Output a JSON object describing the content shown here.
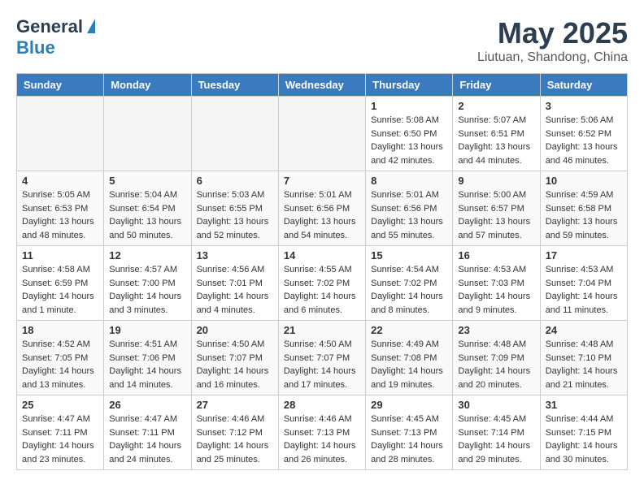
{
  "header": {
    "logo_general": "General",
    "logo_blue": "Blue",
    "month_title": "May 2025",
    "location": "Liutuan, Shandong, China"
  },
  "weekdays": [
    "Sunday",
    "Monday",
    "Tuesday",
    "Wednesday",
    "Thursday",
    "Friday",
    "Saturday"
  ],
  "weeks": [
    [
      {
        "day": "",
        "info": ""
      },
      {
        "day": "",
        "info": ""
      },
      {
        "day": "",
        "info": ""
      },
      {
        "day": "",
        "info": ""
      },
      {
        "day": "1",
        "info": "Sunrise: 5:08 AM\nSunset: 6:50 PM\nDaylight: 13 hours\nand 42 minutes."
      },
      {
        "day": "2",
        "info": "Sunrise: 5:07 AM\nSunset: 6:51 PM\nDaylight: 13 hours\nand 44 minutes."
      },
      {
        "day": "3",
        "info": "Sunrise: 5:06 AM\nSunset: 6:52 PM\nDaylight: 13 hours\nand 46 minutes."
      }
    ],
    [
      {
        "day": "4",
        "info": "Sunrise: 5:05 AM\nSunset: 6:53 PM\nDaylight: 13 hours\nand 48 minutes."
      },
      {
        "day": "5",
        "info": "Sunrise: 5:04 AM\nSunset: 6:54 PM\nDaylight: 13 hours\nand 50 minutes."
      },
      {
        "day": "6",
        "info": "Sunrise: 5:03 AM\nSunset: 6:55 PM\nDaylight: 13 hours\nand 52 minutes."
      },
      {
        "day": "7",
        "info": "Sunrise: 5:01 AM\nSunset: 6:56 PM\nDaylight: 13 hours\nand 54 minutes."
      },
      {
        "day": "8",
        "info": "Sunrise: 5:01 AM\nSunset: 6:56 PM\nDaylight: 13 hours\nand 55 minutes."
      },
      {
        "day": "9",
        "info": "Sunrise: 5:00 AM\nSunset: 6:57 PM\nDaylight: 13 hours\nand 57 minutes."
      },
      {
        "day": "10",
        "info": "Sunrise: 4:59 AM\nSunset: 6:58 PM\nDaylight: 13 hours\nand 59 minutes."
      }
    ],
    [
      {
        "day": "11",
        "info": "Sunrise: 4:58 AM\nSunset: 6:59 PM\nDaylight: 14 hours\nand 1 minute."
      },
      {
        "day": "12",
        "info": "Sunrise: 4:57 AM\nSunset: 7:00 PM\nDaylight: 14 hours\nand 3 minutes."
      },
      {
        "day": "13",
        "info": "Sunrise: 4:56 AM\nSunset: 7:01 PM\nDaylight: 14 hours\nand 4 minutes."
      },
      {
        "day": "14",
        "info": "Sunrise: 4:55 AM\nSunset: 7:02 PM\nDaylight: 14 hours\nand 6 minutes."
      },
      {
        "day": "15",
        "info": "Sunrise: 4:54 AM\nSunset: 7:02 PM\nDaylight: 14 hours\nand 8 minutes."
      },
      {
        "day": "16",
        "info": "Sunrise: 4:53 AM\nSunset: 7:03 PM\nDaylight: 14 hours\nand 9 minutes."
      },
      {
        "day": "17",
        "info": "Sunrise: 4:53 AM\nSunset: 7:04 PM\nDaylight: 14 hours\nand 11 minutes."
      }
    ],
    [
      {
        "day": "18",
        "info": "Sunrise: 4:52 AM\nSunset: 7:05 PM\nDaylight: 14 hours\nand 13 minutes."
      },
      {
        "day": "19",
        "info": "Sunrise: 4:51 AM\nSunset: 7:06 PM\nDaylight: 14 hours\nand 14 minutes."
      },
      {
        "day": "20",
        "info": "Sunrise: 4:50 AM\nSunset: 7:07 PM\nDaylight: 14 hours\nand 16 minutes."
      },
      {
        "day": "21",
        "info": "Sunrise: 4:50 AM\nSunset: 7:07 PM\nDaylight: 14 hours\nand 17 minutes."
      },
      {
        "day": "22",
        "info": "Sunrise: 4:49 AM\nSunset: 7:08 PM\nDaylight: 14 hours\nand 19 minutes."
      },
      {
        "day": "23",
        "info": "Sunrise: 4:48 AM\nSunset: 7:09 PM\nDaylight: 14 hours\nand 20 minutes."
      },
      {
        "day": "24",
        "info": "Sunrise: 4:48 AM\nSunset: 7:10 PM\nDaylight: 14 hours\nand 21 minutes."
      }
    ],
    [
      {
        "day": "25",
        "info": "Sunrise: 4:47 AM\nSunset: 7:11 PM\nDaylight: 14 hours\nand 23 minutes."
      },
      {
        "day": "26",
        "info": "Sunrise: 4:47 AM\nSunset: 7:11 PM\nDaylight: 14 hours\nand 24 minutes."
      },
      {
        "day": "27",
        "info": "Sunrise: 4:46 AM\nSunset: 7:12 PM\nDaylight: 14 hours\nand 25 minutes."
      },
      {
        "day": "28",
        "info": "Sunrise: 4:46 AM\nSunset: 7:13 PM\nDaylight: 14 hours\nand 26 minutes."
      },
      {
        "day": "29",
        "info": "Sunrise: 4:45 AM\nSunset: 7:13 PM\nDaylight: 14 hours\nand 28 minutes."
      },
      {
        "day": "30",
        "info": "Sunrise: 4:45 AM\nSunset: 7:14 PM\nDaylight: 14 hours\nand 29 minutes."
      },
      {
        "day": "31",
        "info": "Sunrise: 4:44 AM\nSunset: 7:15 PM\nDaylight: 14 hours\nand 30 minutes."
      }
    ]
  ]
}
